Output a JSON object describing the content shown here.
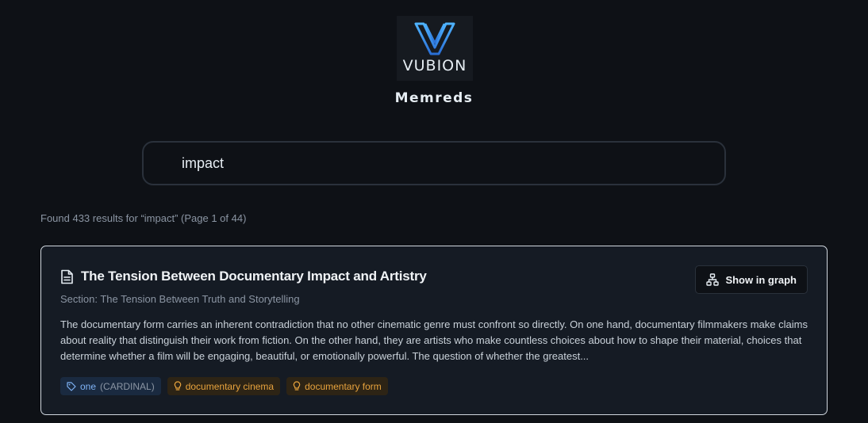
{
  "brand": {
    "logo_text": "VUBION",
    "app_name": "Memreds",
    "accent_color": "#3b9cf0"
  },
  "search": {
    "value": "impact"
  },
  "results": {
    "summary": "Found 433 results for “impact” (Page 1 of 44)",
    "items": [
      {
        "icon": "document-icon",
        "title": "The Tension Between Documentary Impact and Artistry",
        "section": "Section: The Tension Between Truth and Storytelling",
        "excerpt": "The documentary form carries an inherent contradiction that no other cinematic genre must confront so directly. On one hand, documentary filmmakers make claims about reality that distinguish their work from fiction. On the other hand, they are artists who make countless choices about how to shape their material, choices that determine whether a film will be engaging, beautiful, or emotionally powerful. The question of whether the greatest...",
        "graph_button_label": "Show in graph",
        "tags": [
          {
            "kind": "entity",
            "icon": "tag-icon",
            "label": "one",
            "type": "(CARDINAL)"
          },
          {
            "kind": "concept",
            "icon": "lightbulb-icon",
            "label": "documentary cinema"
          },
          {
            "kind": "concept",
            "icon": "lightbulb-icon",
            "label": "documentary form"
          }
        ]
      }
    ]
  }
}
